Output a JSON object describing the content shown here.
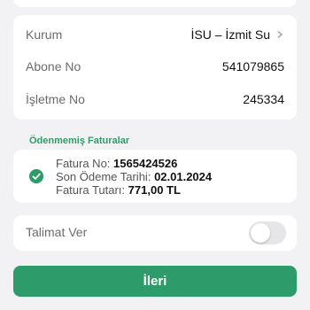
{
  "subscription": {
    "institution_label": "Kurum",
    "institution_value": "İSU – İzmit Su",
    "subscriber_label": "Abone No",
    "subscriber_value": "541079865",
    "facility_label": "İşletme No",
    "facility_value": "245334"
  },
  "unpaid": {
    "section_title": "Ödenmemiş Faturalar",
    "invoice": {
      "number_label": "Fatura No:",
      "number_value": "1565424526",
      "due_label": "Son Ödeme Tarihi:",
      "due_value": "02.01.2024",
      "amount_label": "Fatura Tutarı:",
      "amount_value": "771,00 TL",
      "selected": true
    }
  },
  "instruction": {
    "label": "Talimat Ver",
    "enabled": false
  },
  "next_button": {
    "label": "İleri"
  },
  "colors": {
    "accent": "#2e9c6a",
    "background": "#f2f2f4"
  },
  "icons": {
    "chevron": "chevron-right-icon",
    "check": "checkmark-circle-icon"
  }
}
